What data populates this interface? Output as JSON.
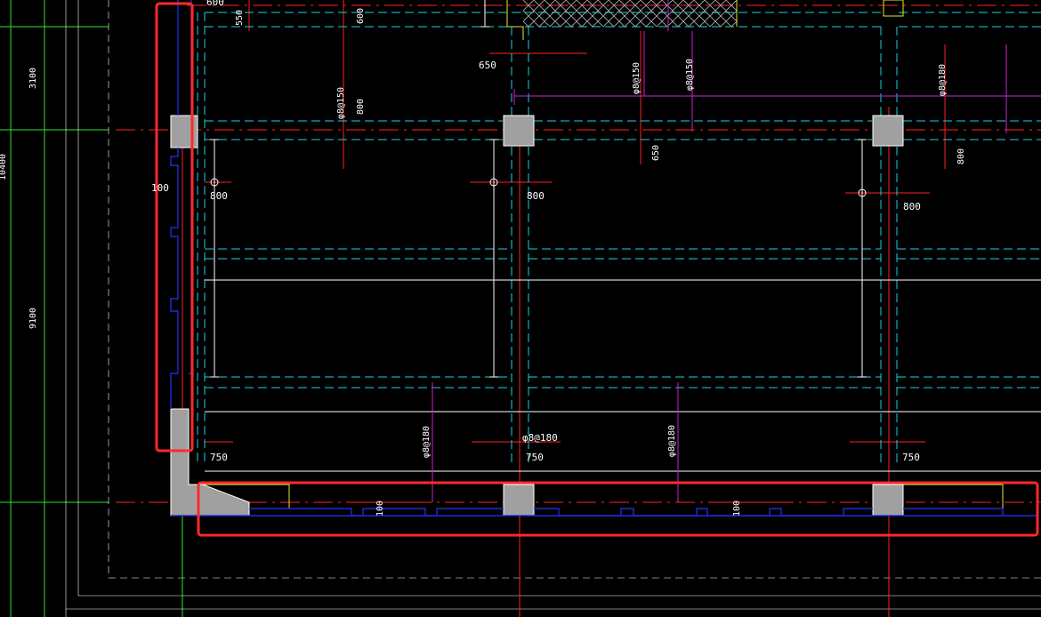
{
  "colors": {
    "background": "#000000",
    "axis_red": "#ff2020",
    "hidden_cyan": "#19d3e0",
    "grid_green": "#2ee62e",
    "wall_blue": "#1f2bd6",
    "rebar_magenta": "#d020d0",
    "edge_yellow": "#e8e830",
    "column_gray": "#a0a0a0",
    "highlight_red": "#ff2a2a",
    "text_white": "#ffffff"
  },
  "dimensions": {
    "left_top": "3100",
    "left_mid": "10400",
    "left_low": "9100",
    "top_600a": "600",
    "top_550": "550",
    "top_600b": "600",
    "d650_top": "650",
    "d650_mid": "650",
    "d800_v1": "800",
    "d800_v2": "800",
    "d800_h1": "800",
    "d800_h2": "800",
    "d800_h3": "800",
    "d100_left": "100",
    "d750_1": "750",
    "d750_2": "750",
    "d750_3": "750",
    "d100_b1": "100",
    "d100_b2": "100"
  },
  "rebar_labels": {
    "r1": "φ8@150",
    "r2": "φ8@150",
    "r3": "φ8@150",
    "r4": "φ8@180",
    "r5": "φ8@180",
    "r6": "φ8@180",
    "r7": "φ8@180"
  }
}
